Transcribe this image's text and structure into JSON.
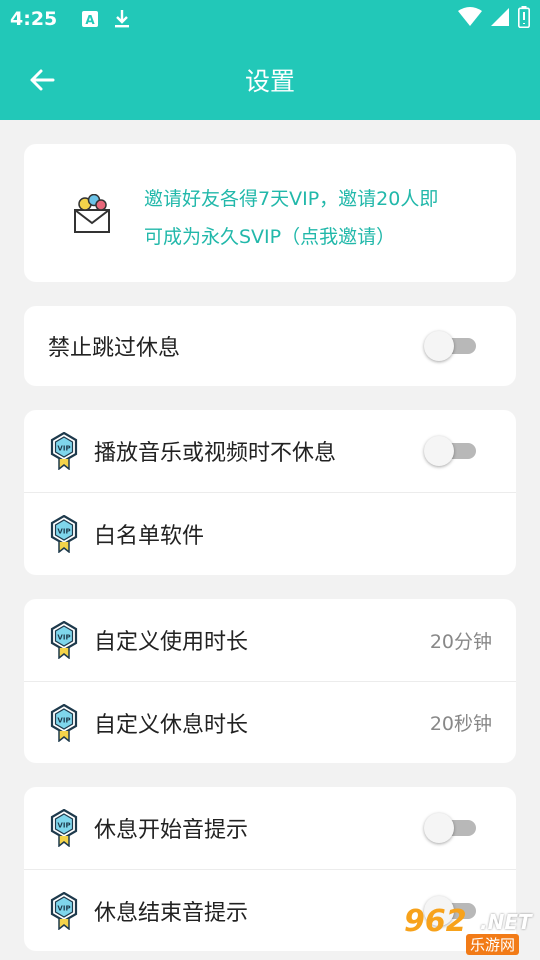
{
  "status_bar": {
    "time": "4:25",
    "icons": [
      "font-download-notification-icon",
      "download-icon"
    ],
    "right_icons": [
      "wifi-icon",
      "signal-icon",
      "battery-icon"
    ]
  },
  "app_bar": {
    "title": "设置"
  },
  "invite": {
    "line1": "邀请好友各得7天VIP，邀请20人即",
    "line2": "可成为永久SVIP（点我邀请）"
  },
  "settings": {
    "no_skip_rest": {
      "label": "禁止跳过休息",
      "enabled": false
    },
    "no_rest_media": {
      "label": "播放音乐或视频时不休息",
      "enabled": false
    },
    "whitelist": {
      "label": "白名单软件"
    },
    "custom_use": {
      "label": "自定义使用时长",
      "value": "20分钟"
    },
    "custom_rest": {
      "label": "自定义休息时长",
      "value": "20秒钟"
    },
    "rest_start_sound": {
      "label": "休息开始音提示",
      "enabled": false
    },
    "rest_end_sound": {
      "label": "休息结束音提示",
      "enabled": false
    }
  },
  "watermark": {
    "num": "962",
    "net": ".NET",
    "sub": "乐游网"
  },
  "colors": {
    "primary": "#22c8b8",
    "accent_text": "#22b8aa",
    "background": "#f2f2f2"
  }
}
